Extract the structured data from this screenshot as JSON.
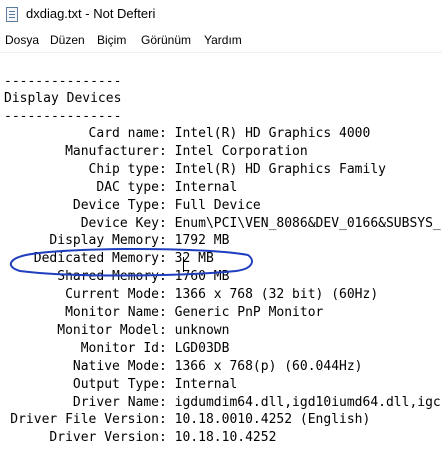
{
  "window": {
    "title": "dxdiag.txt - Not Defteri"
  },
  "menu": [
    "Dosya",
    "Düzen",
    "Biçim",
    "Görünüm",
    "Yardım"
  ],
  "content": {
    "rule_top": "---------------",
    "section_title": "Display Devices",
    "rule_bottom": "---------------",
    "fields": [
      {
        "label": "Card name",
        "value": "Intel(R) HD Graphics 4000"
      },
      {
        "label": "Manufacturer",
        "value": "Intel Corporation"
      },
      {
        "label": "Chip type",
        "value": "Intel(R) HD Graphics Family"
      },
      {
        "label": "DAC type",
        "value": "Internal"
      },
      {
        "label": "Device Type",
        "value": "Full Device"
      },
      {
        "label": "Device Key",
        "value": "Enum\\PCI\\VEN_8086&DEV_0166&SUBSYS_"
      },
      {
        "label": "Display Memory",
        "value": "1792 MB"
      },
      {
        "label": "Dedicated Memory",
        "value": "32 MB"
      },
      {
        "label": "Shared Memory",
        "value": "1760 MB"
      },
      {
        "label": "Current Mode",
        "value": "1366 x 768 (32 bit) (60Hz)"
      },
      {
        "label": "Monitor Name",
        "value": "Generic PnP Monitor"
      },
      {
        "label": "Monitor Model",
        "value": "unknown"
      },
      {
        "label": "Monitor Id",
        "value": "LGD03DB"
      },
      {
        "label": "Native Mode",
        "value": "1366 x 768(p) (60.044Hz)"
      },
      {
        "label": "Output Type",
        "value": "Internal"
      },
      {
        "label": "Driver Name",
        "value": "igdumdim64.dll,igd10iumd64.dll,igc"
      },
      {
        "label": "Driver File Version",
        "value": "10.18.0010.4252 (English)"
      },
      {
        "label": "Driver Version",
        "value": "10.18.10.4252"
      }
    ]
  },
  "annotation": {
    "color": "#1f3fbf"
  }
}
